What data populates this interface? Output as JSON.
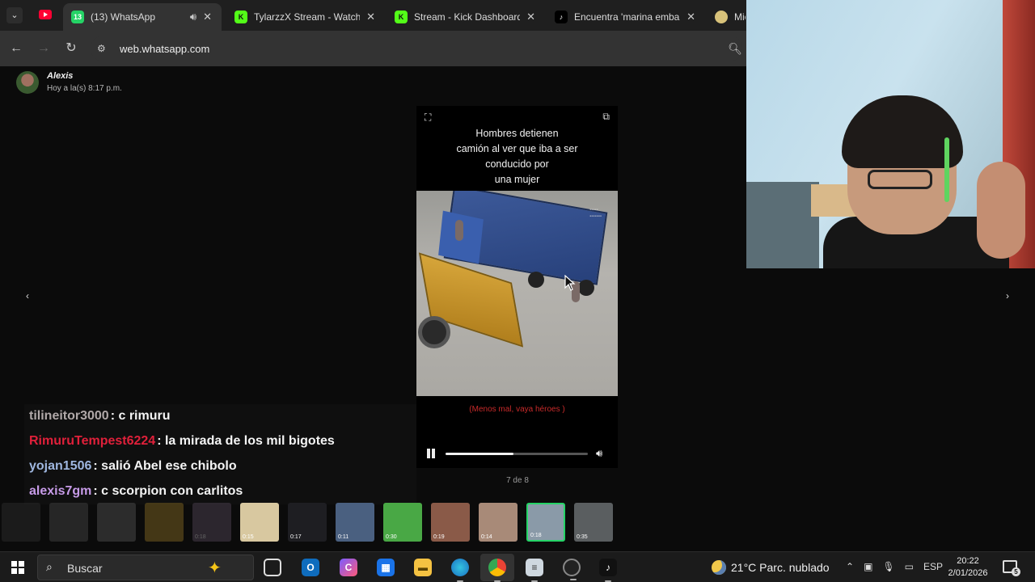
{
  "browser": {
    "tabs": [
      {
        "title": "(13) WhatsApp",
        "badge": "13",
        "active": true
      },
      {
        "title": "TylarzzX Stream - Watch Li",
        "active": false
      },
      {
        "title": "Stream - Kick Dashboard",
        "active": false
      },
      {
        "title": "Encuentra 'marina embara",
        "active": false
      },
      {
        "title": "Mic",
        "active": false
      }
    ],
    "url": "web.whatsapp.com"
  },
  "viewer": {
    "sender_name": "Alexis",
    "sender_time": "Hoy a la(s) 8:17 p.m.",
    "caption": "Hombres detienen\ncamión al ver que iba a ser\nconducido por\nuna mujer",
    "subtitle": "(Menos mal, vaya héroes )",
    "counter": "7 de 8",
    "progress": 0.48,
    "thumbnails": [
      {
        "duration": "",
        "faded": true,
        "color": "#3a3a3a"
      },
      {
        "duration": "",
        "faded": true,
        "color": "#5a5a5a"
      },
      {
        "duration": "",
        "faded": true,
        "color": "#6a6a6a"
      },
      {
        "duration": "",
        "faded": true,
        "color": "#b08a2a"
      },
      {
        "duration": "0:18",
        "faded": true,
        "color": "#6a5a70"
      },
      {
        "duration": "0:15",
        "faded": false,
        "color": "#d8c8a0"
      },
      {
        "duration": "0:17",
        "faded": false,
        "color": "#1e1e22"
      },
      {
        "duration": "0:11",
        "faded": false,
        "color": "#4a6080"
      },
      {
        "duration": "0:30",
        "faded": false,
        "color": "#49a845"
      },
      {
        "duration": "0:19",
        "faded": false,
        "color": "#8a5a48"
      },
      {
        "duration": "0:14",
        "faded": false,
        "color": "#a88a78"
      },
      {
        "duration": "0:18",
        "faded": false,
        "color": "#8a9aa8",
        "selected": true
      },
      {
        "duration": "0:35",
        "faded": false,
        "color": "#5a5e60"
      }
    ]
  },
  "chat": [
    {
      "user": "tilineitor3000",
      "message": ": c rimuru",
      "color": "#b0a8a8"
    },
    {
      "user": "RimuruTempest6224",
      "message": ": la mirada de los mil bigotes",
      "color": "#e0203a"
    },
    {
      "user": "yojan1506",
      "message": ": salió Abel ese chibolo",
      "color": "#9fb7e0"
    },
    {
      "user": "alexis7gm",
      "message": ": c scorpion con carlitos",
      "color": "#c79be8"
    }
  ],
  "taskbar": {
    "search_label": "Buscar",
    "weather": "21°C  Parc. nublado",
    "language": "ESP",
    "time": "20:22",
    "date": "2/01/2026",
    "notifications": "5"
  },
  "colors": {
    "accent": "#25d366",
    "kick_green": "#53fc18",
    "youtube_red": "#ff0033"
  }
}
